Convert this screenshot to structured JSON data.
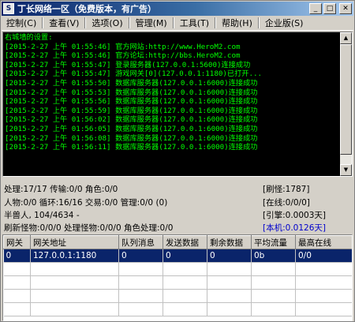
{
  "window": {
    "title": "丁长网络一区（免费版本，有广告）",
    "icon_glyph": "S",
    "buttons": {
      "minimize": "_",
      "maximize": "□",
      "close": "✕"
    }
  },
  "menu": [
    "控制(C)",
    "查看(V)",
    "选项(O)",
    "管理(M)",
    "工具(T)",
    "帮助(H)",
    "企业版(S)"
  ],
  "log": [
    "右城墙的设置:",
    "[2015-2-27 上午 01:55:46] 官方网站:http://www.HeroM2.com",
    "[2015-2-27 上午 01:55:46] 官方论坛:http://bbs.HeroM2.com",
    "[2015-2-27 上午 01:55:47] 登录服务器(127.0.0.1:5600)连接成功",
    "[2015-2-27 上午 01:55:47] 游戏网关[0](127.0.0.1:1180)已打开...",
    "[2015-2-27 上午 01:55:50] 数据库服务器(127.0.0.1:6000)连接成功",
    "[2015-2-27 上午 01:55:53] 数据库服务器(127.0.0.1:6000)连接成功",
    "[2015-2-27 上午 01:55:56] 数据库服务器(127.0.0.1:6000)连接成功",
    "[2015-2-27 上午 01:55:59] 数据库服务器(127.0.0.1:6000)连接成功",
    "[2015-2-27 上午 01:56:02] 数据库服务器(127.0.0.1:6000)连接成功",
    "[2015-2-27 上午 01:56:05] 数据库服务器(127.0.0.1:6000)连接成功",
    "[2015-2-27 上午 01:56:08] 数据库服务器(127.0.0.1:6000)连接成功",
    "[2015-2-27 上午 01:56:11] 数据库服务器(127.0.0.1:6000)连接成功"
  ],
  "status": {
    "line1": "处理:17/17 传输:0/0 角色:0/0",
    "line2": "人物:0/0 循环:16/16 交易:0/0 管理:0/0 (0)",
    "line3": "半兽人, 104/4634 -",
    "line4": "刷新怪物:0/0/0 处理怪物:0/0/0 角色处理:0/0",
    "refresh": "[刷怪:1787]",
    "online": "[在线:0/0/0]",
    "engine": "[引擎:0.0003天]",
    "local": "[本机:0.0126天]"
  },
  "table": {
    "columns": [
      "网关",
      "网关地址",
      "队列消息",
      "发送数据",
      "剩余数据",
      "平均流量",
      "最高在线"
    ],
    "rows": [
      [
        "0",
        "127.0.0.1:1180",
        "0",
        "0",
        "0",
        "0b",
        "0/0"
      ]
    ]
  },
  "colors": {
    "log_text": "#00ff00",
    "log_bg": "#000000",
    "selection": "#0a246a",
    "highlight_blue": "#0000cc"
  }
}
